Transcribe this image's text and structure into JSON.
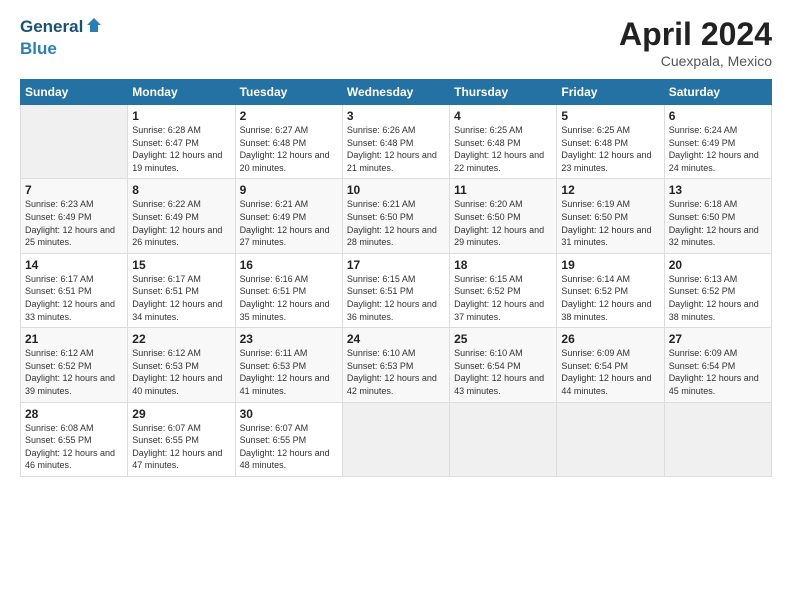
{
  "header": {
    "logo_line1": "General",
    "logo_line2": "Blue",
    "month": "April 2024",
    "location": "Cuexpala, Mexico"
  },
  "weekdays": [
    "Sunday",
    "Monday",
    "Tuesday",
    "Wednesday",
    "Thursday",
    "Friday",
    "Saturday"
  ],
  "weeks": [
    [
      {
        "day": "",
        "sunrise": "",
        "sunset": "",
        "daylight": ""
      },
      {
        "day": "1",
        "sunrise": "Sunrise: 6:28 AM",
        "sunset": "Sunset: 6:47 PM",
        "daylight": "Daylight: 12 hours and 19 minutes."
      },
      {
        "day": "2",
        "sunrise": "Sunrise: 6:27 AM",
        "sunset": "Sunset: 6:48 PM",
        "daylight": "Daylight: 12 hours and 20 minutes."
      },
      {
        "day": "3",
        "sunrise": "Sunrise: 6:26 AM",
        "sunset": "Sunset: 6:48 PM",
        "daylight": "Daylight: 12 hours and 21 minutes."
      },
      {
        "day": "4",
        "sunrise": "Sunrise: 6:25 AM",
        "sunset": "Sunset: 6:48 PM",
        "daylight": "Daylight: 12 hours and 22 minutes."
      },
      {
        "day": "5",
        "sunrise": "Sunrise: 6:25 AM",
        "sunset": "Sunset: 6:48 PM",
        "daylight": "Daylight: 12 hours and 23 minutes."
      },
      {
        "day": "6",
        "sunrise": "Sunrise: 6:24 AM",
        "sunset": "Sunset: 6:49 PM",
        "daylight": "Daylight: 12 hours and 24 minutes."
      }
    ],
    [
      {
        "day": "7",
        "sunrise": "Sunrise: 6:23 AM",
        "sunset": "Sunset: 6:49 PM",
        "daylight": "Daylight: 12 hours and 25 minutes."
      },
      {
        "day": "8",
        "sunrise": "Sunrise: 6:22 AM",
        "sunset": "Sunset: 6:49 PM",
        "daylight": "Daylight: 12 hours and 26 minutes."
      },
      {
        "day": "9",
        "sunrise": "Sunrise: 6:21 AM",
        "sunset": "Sunset: 6:49 PM",
        "daylight": "Daylight: 12 hours and 27 minutes."
      },
      {
        "day": "10",
        "sunrise": "Sunrise: 6:21 AM",
        "sunset": "Sunset: 6:50 PM",
        "daylight": "Daylight: 12 hours and 28 minutes."
      },
      {
        "day": "11",
        "sunrise": "Sunrise: 6:20 AM",
        "sunset": "Sunset: 6:50 PM",
        "daylight": "Daylight: 12 hours and 29 minutes."
      },
      {
        "day": "12",
        "sunrise": "Sunrise: 6:19 AM",
        "sunset": "Sunset: 6:50 PM",
        "daylight": "Daylight: 12 hours and 31 minutes."
      },
      {
        "day": "13",
        "sunrise": "Sunrise: 6:18 AM",
        "sunset": "Sunset: 6:50 PM",
        "daylight": "Daylight: 12 hours and 32 minutes."
      }
    ],
    [
      {
        "day": "14",
        "sunrise": "Sunrise: 6:17 AM",
        "sunset": "Sunset: 6:51 PM",
        "daylight": "Daylight: 12 hours and 33 minutes."
      },
      {
        "day": "15",
        "sunrise": "Sunrise: 6:17 AM",
        "sunset": "Sunset: 6:51 PM",
        "daylight": "Daylight: 12 hours and 34 minutes."
      },
      {
        "day": "16",
        "sunrise": "Sunrise: 6:16 AM",
        "sunset": "Sunset: 6:51 PM",
        "daylight": "Daylight: 12 hours and 35 minutes."
      },
      {
        "day": "17",
        "sunrise": "Sunrise: 6:15 AM",
        "sunset": "Sunset: 6:51 PM",
        "daylight": "Daylight: 12 hours and 36 minutes."
      },
      {
        "day": "18",
        "sunrise": "Sunrise: 6:15 AM",
        "sunset": "Sunset: 6:52 PM",
        "daylight": "Daylight: 12 hours and 37 minutes."
      },
      {
        "day": "19",
        "sunrise": "Sunrise: 6:14 AM",
        "sunset": "Sunset: 6:52 PM",
        "daylight": "Daylight: 12 hours and 38 minutes."
      },
      {
        "day": "20",
        "sunrise": "Sunrise: 6:13 AM",
        "sunset": "Sunset: 6:52 PM",
        "daylight": "Daylight: 12 hours and 38 minutes."
      }
    ],
    [
      {
        "day": "21",
        "sunrise": "Sunrise: 6:12 AM",
        "sunset": "Sunset: 6:52 PM",
        "daylight": "Daylight: 12 hours and 39 minutes."
      },
      {
        "day": "22",
        "sunrise": "Sunrise: 6:12 AM",
        "sunset": "Sunset: 6:53 PM",
        "daylight": "Daylight: 12 hours and 40 minutes."
      },
      {
        "day": "23",
        "sunrise": "Sunrise: 6:11 AM",
        "sunset": "Sunset: 6:53 PM",
        "daylight": "Daylight: 12 hours and 41 minutes."
      },
      {
        "day": "24",
        "sunrise": "Sunrise: 6:10 AM",
        "sunset": "Sunset: 6:53 PM",
        "daylight": "Daylight: 12 hours and 42 minutes."
      },
      {
        "day": "25",
        "sunrise": "Sunrise: 6:10 AM",
        "sunset": "Sunset: 6:54 PM",
        "daylight": "Daylight: 12 hours and 43 minutes."
      },
      {
        "day": "26",
        "sunrise": "Sunrise: 6:09 AM",
        "sunset": "Sunset: 6:54 PM",
        "daylight": "Daylight: 12 hours and 44 minutes."
      },
      {
        "day": "27",
        "sunrise": "Sunrise: 6:09 AM",
        "sunset": "Sunset: 6:54 PM",
        "daylight": "Daylight: 12 hours and 45 minutes."
      }
    ],
    [
      {
        "day": "28",
        "sunrise": "Sunrise: 6:08 AM",
        "sunset": "Sunset: 6:55 PM",
        "daylight": "Daylight: 12 hours and 46 minutes."
      },
      {
        "day": "29",
        "sunrise": "Sunrise: 6:07 AM",
        "sunset": "Sunset: 6:55 PM",
        "daylight": "Daylight: 12 hours and 47 minutes."
      },
      {
        "day": "30",
        "sunrise": "Sunrise: 6:07 AM",
        "sunset": "Sunset: 6:55 PM",
        "daylight": "Daylight: 12 hours and 48 minutes."
      },
      {
        "day": "",
        "sunrise": "",
        "sunset": "",
        "daylight": ""
      },
      {
        "day": "",
        "sunrise": "",
        "sunset": "",
        "daylight": ""
      },
      {
        "day": "",
        "sunrise": "",
        "sunset": "",
        "daylight": ""
      },
      {
        "day": "",
        "sunrise": "",
        "sunset": "",
        "daylight": ""
      }
    ]
  ]
}
